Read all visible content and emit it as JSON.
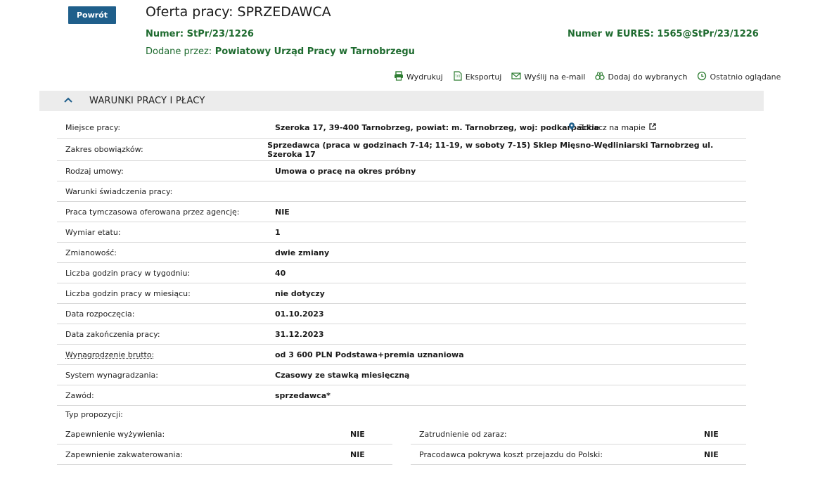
{
  "header": {
    "back_label": "Powrót",
    "title": "Oferta pracy: SPRZEDAWCA",
    "number_label": "Numer:",
    "number_value": "StPr/23/1226",
    "eures_label": "Numer w EURES:",
    "eures_value": "1565@StPr/23/1226",
    "added_label": "Dodane przez:",
    "added_value": "Powiatowy Urząd Pracy w Tarnobrzegu"
  },
  "actions": {
    "print": "Wydrukuj",
    "export": "Eksportuj",
    "email": "Wyślij na e-mail",
    "favorite": "Dodaj do wybranych",
    "recent": "Ostatnio oglądane"
  },
  "section": {
    "title": "WARUNKI PRACY I PŁACY"
  },
  "map_link": "Zobacz na mapie",
  "rows": [
    {
      "label": "Miejsce pracy:",
      "value": "Szeroka 17, 39-400 Tarnobrzeg, powiat: m. Tarnobrzeg, woj: podkarpackie"
    },
    {
      "label": "Zakres obowiązków:",
      "value": "Sprzedawca (praca w godzinach 7-14; 11-19, w soboty 7-15) Sklep Mięsno-Wędliniarski Tarnobrzeg ul. Szeroka 17"
    },
    {
      "label": "Rodzaj umowy:",
      "value": "Umowa o pracę na okres próbny"
    },
    {
      "label": "Warunki świadczenia pracy:",
      "value": ""
    },
    {
      "label": "Praca tymczasowa oferowana przez agencję:",
      "value": "NIE"
    },
    {
      "label": "Wymiar etatu:",
      "value": "1"
    },
    {
      "label": "Zmianowość:",
      "value": "dwie zmiany"
    },
    {
      "label": "Liczba godzin pracy w tygodniu:",
      "value": "40"
    },
    {
      "label": "Liczba godzin pracy w miesiącu:",
      "value": "nie dotyczy"
    },
    {
      "label": "Data rozpoczęcia:",
      "value": "01.10.2023"
    },
    {
      "label": "Data zakończenia pracy:",
      "value": "31.12.2023"
    },
    {
      "label": "Wynagrodzenie brutto:",
      "value": "od 3 600 PLN Podstawa+premia uznaniowa"
    },
    {
      "label": "System wynagradzania:",
      "value": "Czasowy ze stawką miesięczną"
    },
    {
      "label": "Zawód:",
      "value": "sprzedawca*"
    }
  ],
  "proposals": {
    "label": "Typ propozycji:",
    "left": [
      {
        "label": "Zapewnienie wyżywienia:",
        "value": "NIE"
      },
      {
        "label": "Zapewnienie zakwaterowania:",
        "value": "NIE"
      }
    ],
    "right": [
      {
        "label": "Zatrudnienie od zaraz:",
        "value": "NIE"
      },
      {
        "label": "Pracodawca pokrywa koszt przejazdu do Polski:",
        "value": "NIE"
      }
    ]
  }
}
